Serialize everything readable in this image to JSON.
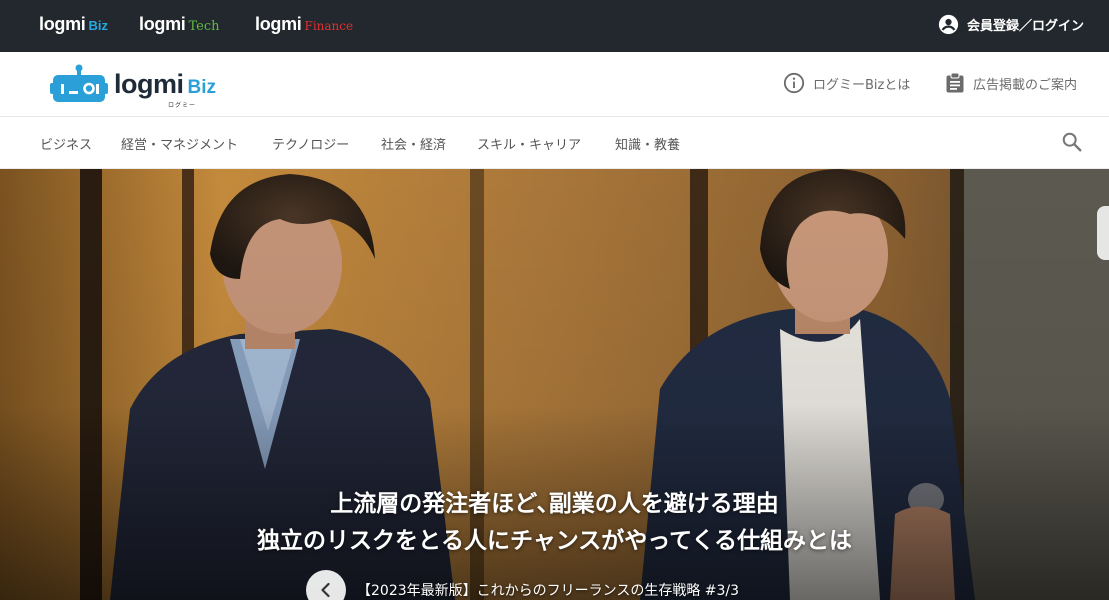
{
  "network_bar": {
    "sites": [
      {
        "base": "logmi",
        "sub": "Biz"
      },
      {
        "base": "logmi",
        "sub": "Tech"
      },
      {
        "base": "logmi",
        "sub": "Finance"
      }
    ],
    "login_label": "会員登録／ログイン",
    "login_icon": "account-circle-icon"
  },
  "header": {
    "brand": {
      "main": "logmi",
      "sub": "Biz",
      "kana": "ログミー"
    },
    "about_label": "ログミーBizとは",
    "ads_label": "広告掲載のご案内"
  },
  "categories": [
    "ビジネス",
    "経営・マネジメント",
    "テクノロジー",
    "社会・経済",
    "スキル・キャリア",
    "知識・教養"
  ],
  "hero": {
    "title_line1": "上流層の発注者ほど､副業の人を避ける理由",
    "title_line2": "独立のリスクをとる人にチャンスがやってくる仕組みとは",
    "series": "【2023年最新版】これからのフリーランスの生存戦略 #3/3"
  },
  "colors": {
    "topbar": "#22282d",
    "biz_accent": "#2aa8e0",
    "tech_accent": "#5fbb46",
    "finance_accent": "#e03030"
  }
}
